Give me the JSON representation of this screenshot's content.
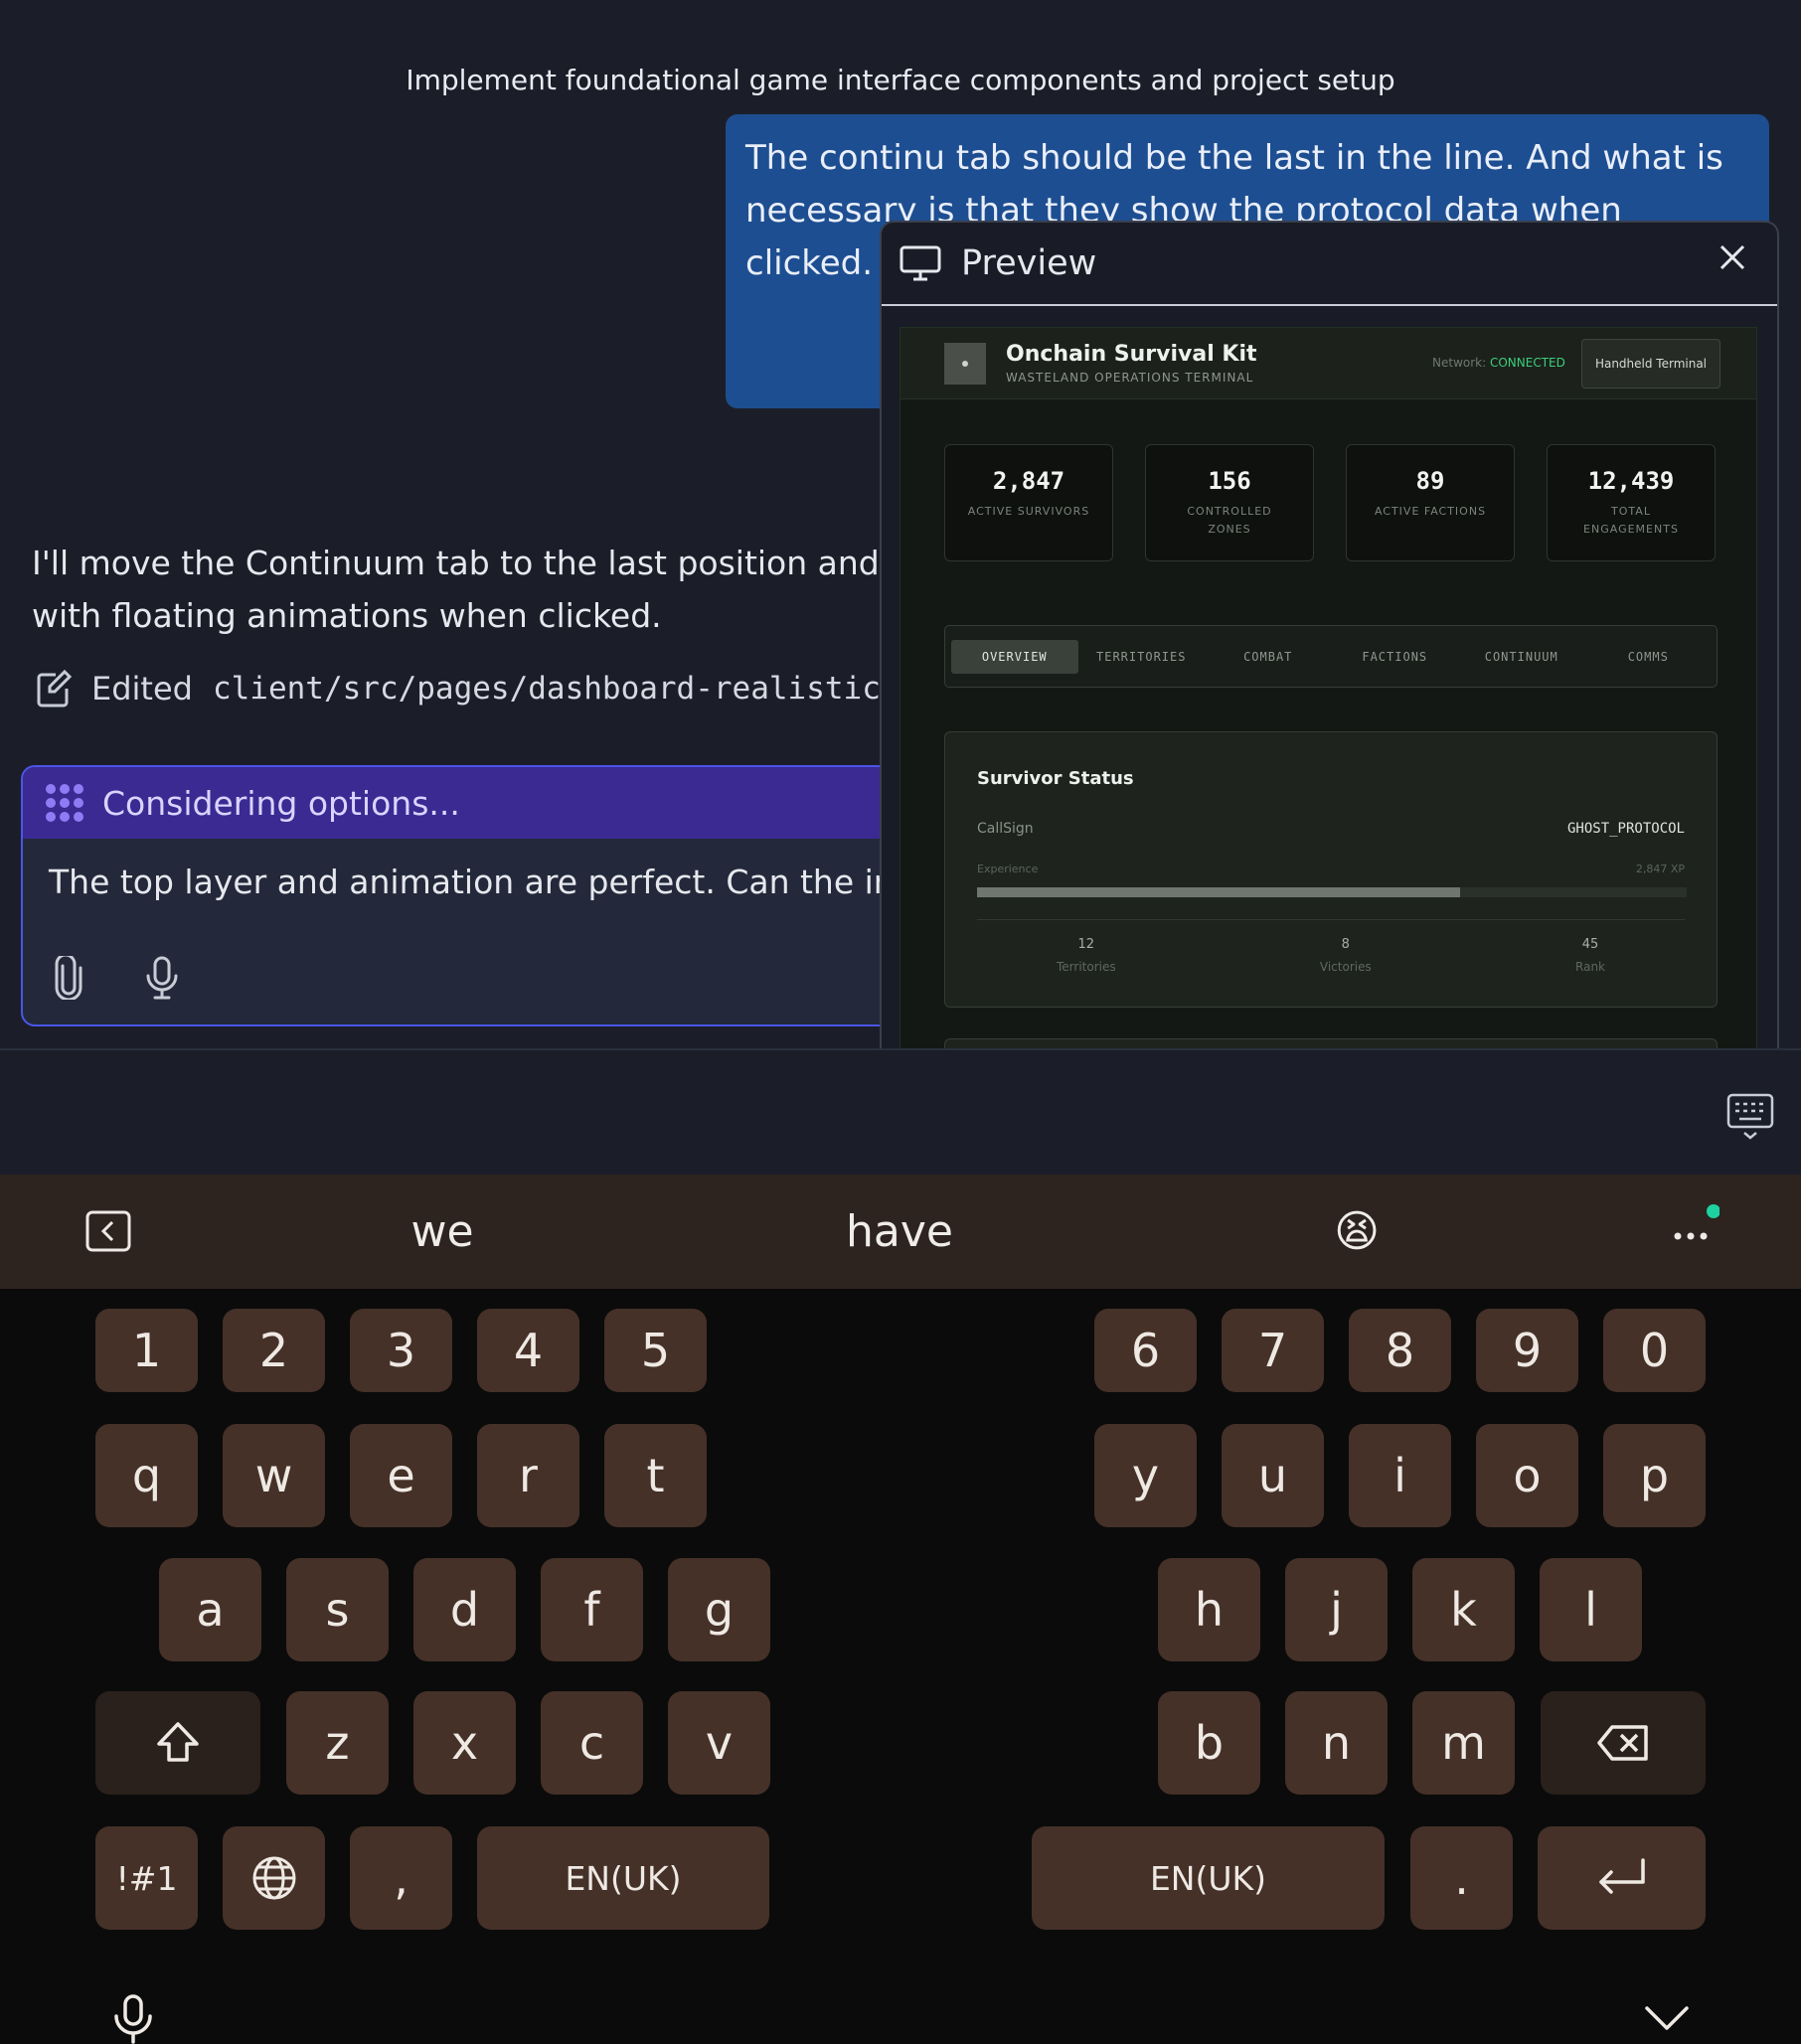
{
  "thread": {
    "title": "Implement foundational game interface components and project setup"
  },
  "user_message": {
    "text": "The continu tab should be the last in the line. And what is necessary is that they show the protocol data when clicked. Perhaps a floating digital ho code. All open and"
  },
  "assistant_message": {
    "text_line1": "I'll move the Continuum tab to the last position and create",
    "text_line2": "with floating animations when clicked.",
    "edited_label": "Edited",
    "edited_path": "client/src/pages/dashboard-realistic.t"
  },
  "compose": {
    "status": "Considering options...",
    "input_value": "The top layer and animation are perfect. Can the inner ci"
  },
  "preview": {
    "title": "Preview",
    "game": {
      "title": "Onchain Survival Kit",
      "subtitle": "WASTELAND OPERATIONS TERMINAL",
      "network_label": "Network:",
      "network_status": "CONNECTED",
      "terminal_button": "Handheld Terminal",
      "stats": [
        {
          "value": "2,847",
          "label": "ACTIVE SURVIVORS"
        },
        {
          "value": "156",
          "label": "CONTROLLED ZONES"
        },
        {
          "value": "89",
          "label": "ACTIVE FACTIONS"
        },
        {
          "value": "12,439",
          "label": "TOTAL ENGAGEMENTS"
        }
      ],
      "tabs": [
        "OVERVIEW",
        "TERRITORIES",
        "COMBAT",
        "FACTIONS",
        "CONTINUUM",
        "COMMS"
      ],
      "active_tab": "OVERVIEW",
      "status_card": {
        "title": "Survivor Status",
        "callsign_label": "CallSign",
        "callsign_value": "GHOST_PROTOCOL",
        "experience_label": "Experience",
        "experience_value": "2,847 XP",
        "experience_progress": 0.68,
        "metrics": [
          {
            "value": "12",
            "label": "Territories"
          },
          {
            "value": "8",
            "label": "Victories"
          },
          {
            "value": "45",
            "label": "Rank"
          }
        ]
      }
    }
  },
  "keyboard": {
    "suggestions": [
      "we",
      "have",
      "😫"
    ],
    "row_numbers": [
      "1",
      "2",
      "3",
      "4",
      "5",
      "6",
      "7",
      "8",
      "9",
      "0"
    ],
    "row_top": [
      "q",
      "w",
      "e",
      "r",
      "t",
      "y",
      "u",
      "i",
      "o",
      "p"
    ],
    "row_mid": [
      "a",
      "s",
      "d",
      "f",
      "g",
      "h",
      "j",
      "k",
      "l"
    ],
    "row_bottom": [
      "z",
      "x",
      "c",
      "v",
      "b",
      "n",
      "m"
    ],
    "symbols_label": "!#1",
    "comma": ",",
    "period": ".",
    "space_label_left": "EN(UK)",
    "space_label_right": "EN(UK)"
  },
  "colors": {
    "user_bubble": "#1d4e91",
    "compose_header": "#3a2a92",
    "connected": "#3ccf7a",
    "key": "#453128"
  }
}
